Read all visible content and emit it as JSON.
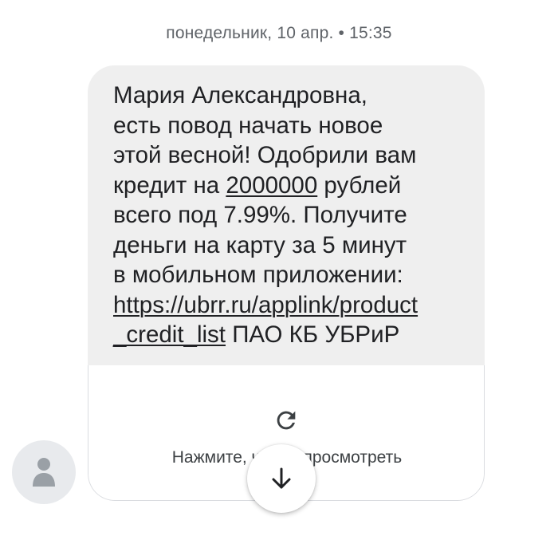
{
  "timestamp": "понедельник, 10 апр. • 15:35",
  "message": {
    "line1": "Мария Александровна,",
    "line2": "есть повод начать новое",
    "line3": "этой весной! Одобрили вам",
    "line4_prefix": "кредит на ",
    "line4_amount": "2000000",
    "line4_suffix": " рублей",
    "line5": "всего под 7.99%. Получите",
    "line6": "деньги на карту за 5 минут",
    "line7": "в мобильном приложении:",
    "link_part1": "https://ubrr.ru/applink/product",
    "link_part2": "_credit_list",
    "line9_suffix": " ПАО КБ УБРиР"
  },
  "link_preview": {
    "icon": "reload-icon",
    "label": "Нажмите, чтобы просмотреть"
  },
  "avatar": {
    "icon": "person-icon"
  },
  "scroll_button": {
    "icon": "arrow-down-icon"
  }
}
